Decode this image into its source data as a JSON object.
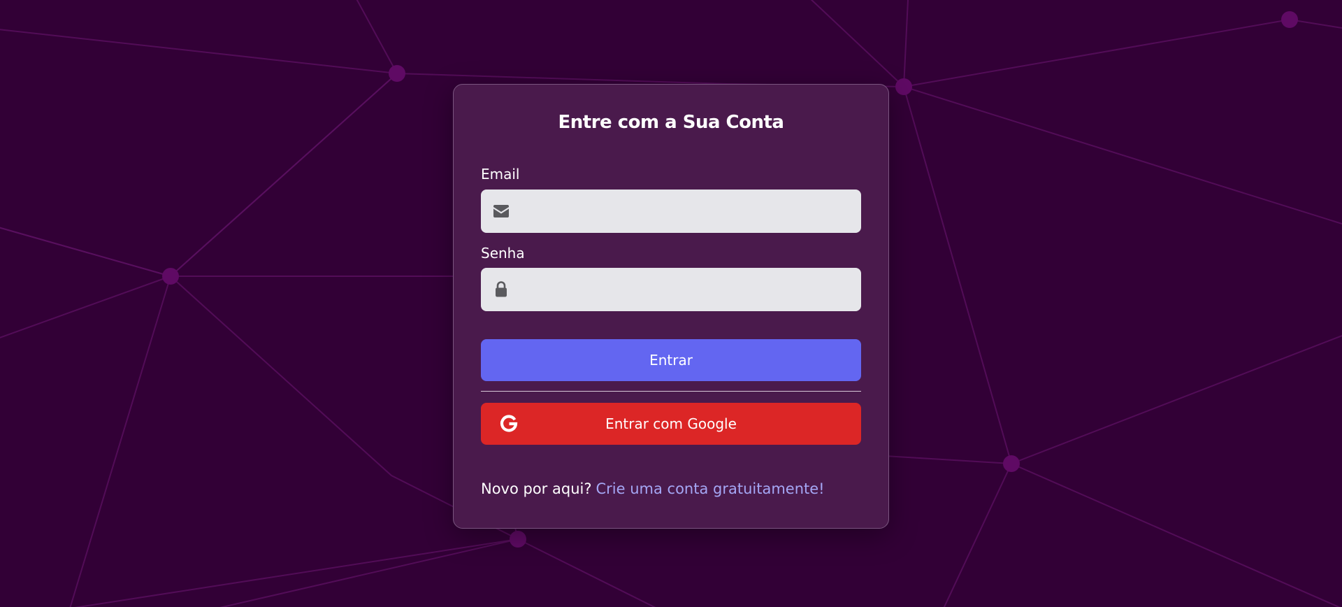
{
  "colors": {
    "background": "#320036",
    "card": "#4a1a4c",
    "primary_button": "#6366f1",
    "google_button": "#dc2626",
    "link": "#a5a7f5",
    "network_lines": "#5a1060",
    "network_nodes": "#5f0a64"
  },
  "form": {
    "title": "Entre com a Sua Conta",
    "email": {
      "label": "Email",
      "value": "",
      "placeholder": "",
      "icon": "envelope-icon"
    },
    "password": {
      "label": "Senha",
      "value": "",
      "placeholder": "",
      "icon": "lock-icon"
    },
    "submit_label": "Entrar",
    "google_label": "Entrar com Google",
    "google_icon": "google-icon"
  },
  "footer": {
    "prompt": "Novo por aqui?",
    "link_text": "Crie uma conta gratuitamente!"
  }
}
